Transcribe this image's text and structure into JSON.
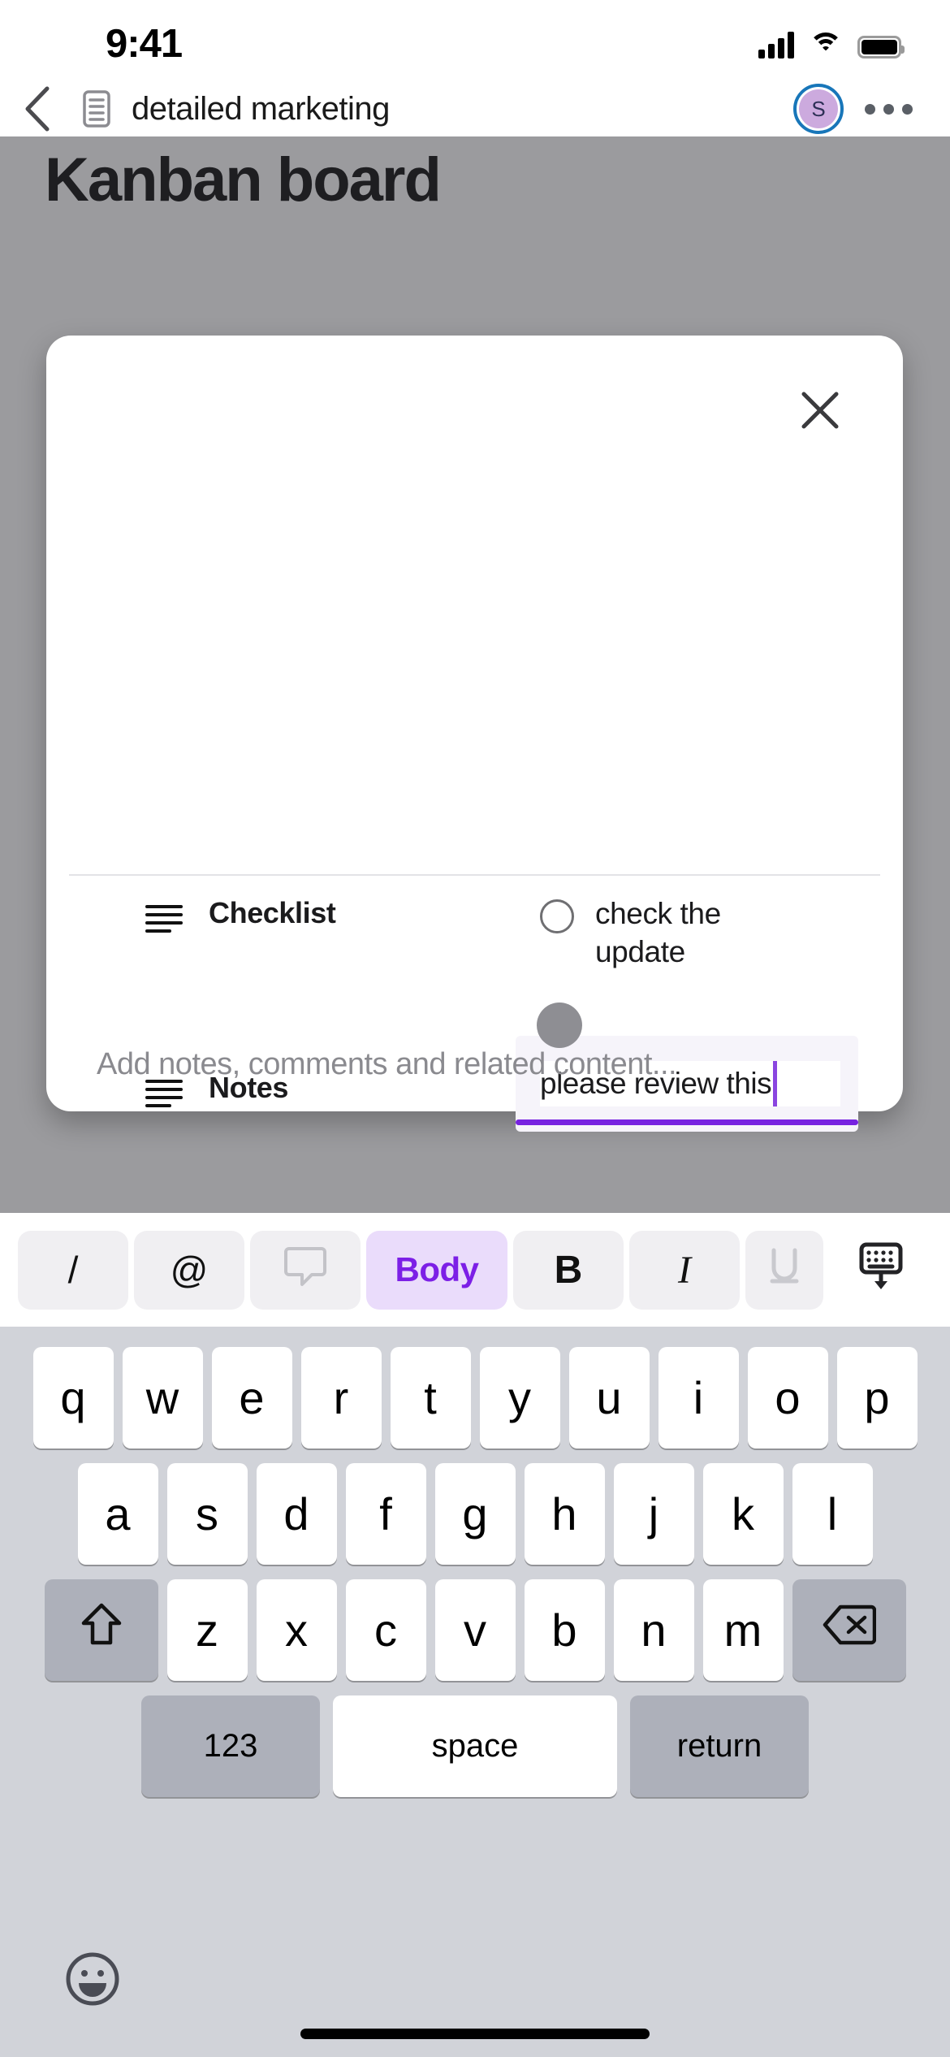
{
  "status_bar": {
    "time": "9:41",
    "cellular_icon": "cellular-signal-icon",
    "wifi_icon": "wifi-icon",
    "battery_icon": "battery-full-icon"
  },
  "nav_bar": {
    "back_icon": "chevron-left-icon",
    "doc_icon": "document-icon",
    "title": "detailed marketing",
    "avatar_initial": "S",
    "avatar_bg": "#ccaade",
    "avatar_ring_color": "#1876b9",
    "overflow_icon": "ellipsis-icon"
  },
  "board": {
    "title": "Kanban board",
    "backdrop_color": "#9b9b9e"
  },
  "modal": {
    "close_icon": "close-icon",
    "properties": [
      {
        "icon": "list-lines-icon",
        "label": "Checklist",
        "value": "check the update",
        "checkbox_state": "unchecked"
      },
      {
        "icon": "list-lines-icon",
        "label": "Notes",
        "value": "please review this",
        "focused": true,
        "accent_color": "#7722e0"
      }
    ],
    "body_placeholder": "Add notes, comments and related content...",
    "drag_handle": "drag-handle-icon"
  },
  "format_toolbar": {
    "items": [
      {
        "label": "/",
        "name": "slash-command-button",
        "active": false
      },
      {
        "label": "@",
        "name": "mention-button",
        "active": false
      },
      {
        "label": "",
        "name": "comment-bubble-icon",
        "active": false
      },
      {
        "label": "Body",
        "name": "text-style-button",
        "active": true
      },
      {
        "label": "B",
        "name": "bold-button",
        "active": false
      },
      {
        "label": "I",
        "name": "italic-button",
        "active": false
      },
      {
        "label": "U",
        "name": "underline-button",
        "active": false
      }
    ],
    "active_color": "#7c1fe6",
    "active_bg": "#eadcfb",
    "dismiss_icon": "keyboard-dismiss-icon"
  },
  "keyboard": {
    "row1": [
      "q",
      "w",
      "e",
      "r",
      "t",
      "y",
      "u",
      "i",
      "o",
      "p"
    ],
    "row2": [
      "a",
      "s",
      "d",
      "f",
      "g",
      "h",
      "j",
      "k",
      "l"
    ],
    "row3": [
      "z",
      "x",
      "c",
      "v",
      "b",
      "n",
      "m"
    ],
    "shift_icon": "shift-up-arrow-icon",
    "backspace_icon": "backspace-delete-icon",
    "numbers_key": "123",
    "space_key": "space",
    "return_key": "return",
    "emoji_icon": "emoji-smiley-icon"
  },
  "home_indicator": "home-indicator"
}
